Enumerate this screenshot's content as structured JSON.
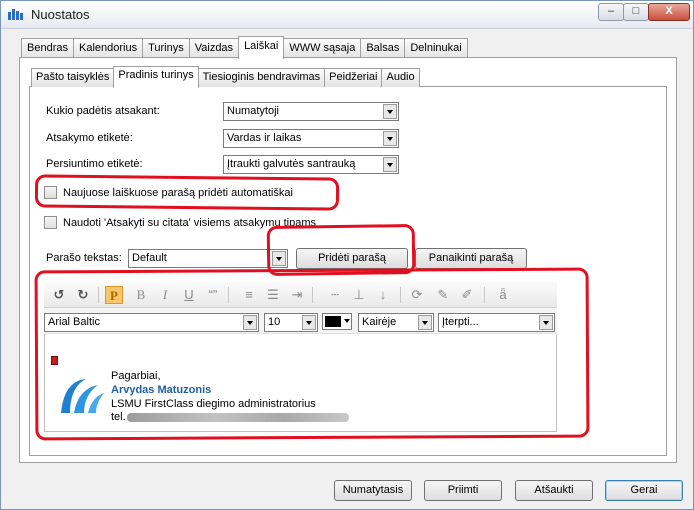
{
  "window": {
    "title": "Nuostatos",
    "controls": {
      "minimize": "–",
      "maximize": "□",
      "close": "X"
    }
  },
  "main_tabs": [
    {
      "label": "Bendras"
    },
    {
      "label": "Kalendorius"
    },
    {
      "label": "Turinys"
    },
    {
      "label": "Vaizdas"
    },
    {
      "label": "Laiškai",
      "active": true
    },
    {
      "label": "WWW sąsaja"
    },
    {
      "label": "Balsas"
    },
    {
      "label": "Delninukai"
    }
  ],
  "sub_tabs": [
    {
      "label": "Pašto taisyklės"
    },
    {
      "label": "Pradinis turinys",
      "active": true
    },
    {
      "label": "Tiesioginis bendravimas"
    },
    {
      "label": "Peidžeriai"
    },
    {
      "label": "Audio"
    }
  ],
  "form": {
    "position": {
      "label": "Kukio padėtis atsakant:",
      "value": "Numatytoji"
    },
    "reply_label": {
      "label": "Atsakymo etiketė:",
      "value": "Vardas ir laikas"
    },
    "forward_label": {
      "label": "Persiuntimo etiketė:",
      "value": "Įtraukti galvutės santrauką"
    },
    "cb_signature": {
      "label": "Naujuose laiškuose parašą pridėti automatiškai",
      "checked": false
    },
    "cb_quote": {
      "label": "Naudoti 'Atsakyti su citata' visiems atsakymų tipams",
      "checked": false
    },
    "signature_text": {
      "label": "Parašo tekstas:",
      "value": "Default"
    },
    "add_signature_button": "Pridėti parašą",
    "remove_signature_button": "Panaikinti parašą"
  },
  "editor": {
    "font": "Arial Baltic",
    "size": "10",
    "text_color": "#000000",
    "align": "Kairėje",
    "insert": "Įterpti...",
    "signature": {
      "greeting": "Pagarbiai,",
      "name": "Arvydas Matuzonis",
      "role": "LSMU FirstClass diegimo administratorius",
      "tel_prefix": "tel."
    }
  },
  "footer": {
    "defaults_button": "Numatytasis",
    "apply_button": "Priimti",
    "cancel_button": "Atšaukti",
    "ok_button": "Gerai"
  },
  "colors": {
    "annotation": "#e01020",
    "signature_name": "#1f5fa5",
    "accent_p": "#f7c66a"
  }
}
